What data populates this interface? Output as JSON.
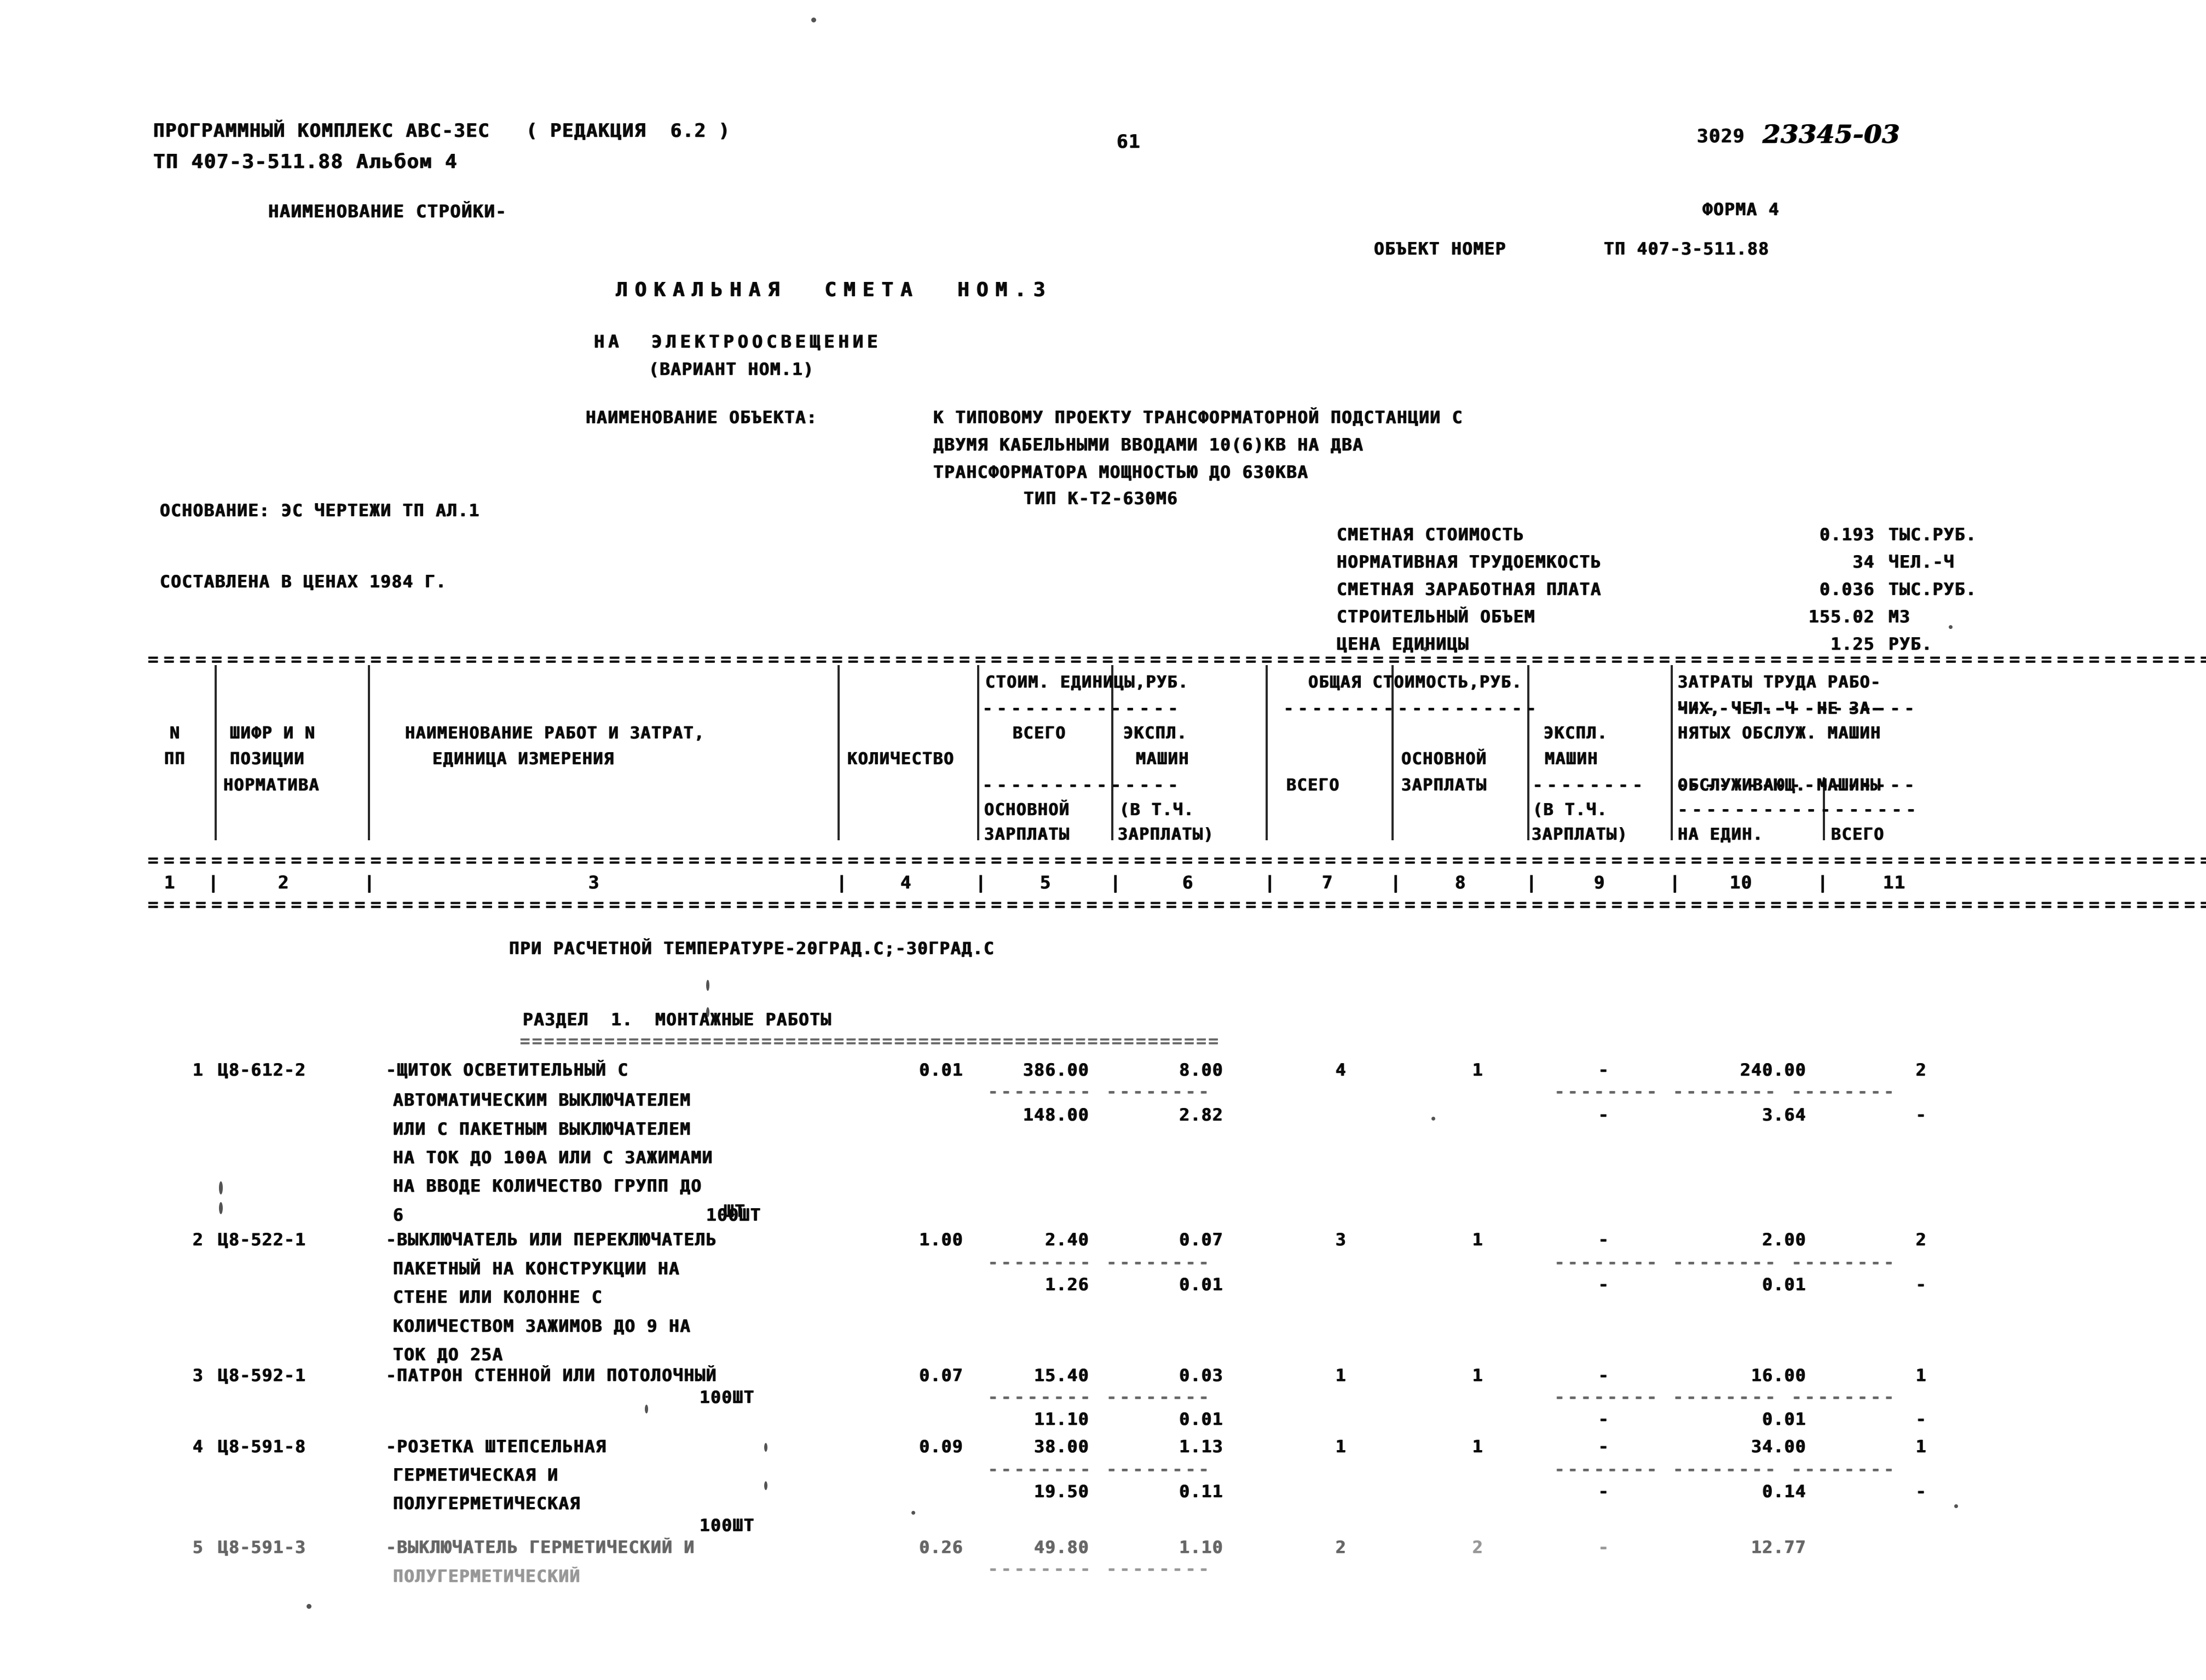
{
  "header": {
    "software_line": "ПРОГРАММНЫЙ КОМПЛЕКС АВС-3ЕС   ( РЕДАКЦИЯ  6.2 )",
    "project_line": "ТП 407-3-511.88 Альбом 4",
    "row_label": "НАИМЕНОВАНИЕ СТРОЙКИ-",
    "page_number": "61",
    "doc_code": "3029",
    "handwritten_code": "23345-03",
    "form_label": "ФОРМА 4",
    "object_number_label": "ОБЪЕКТ НОМЕР",
    "object_number_value": "ТП 407-3-511.88"
  },
  "title": {
    "line1": "ЛОКАЛЬНАЯ  СМЕТА  НОМ.3",
    "line2": "НА  ЭЛЕКТРООСВЕЩЕНИЕ",
    "line3": "(ВАРИАНТ НОМ.1)"
  },
  "object": {
    "label": "НАИМЕНОВАНИЕ ОБЪЕКТА:",
    "lines": [
      "К ТИПОВОМУ ПРОЕКТУ ТРАНСФОРМАТОРНОЙ ПОДСТАНЦИИ С",
      "ДВУМЯ КАБЕЛЬНЫМИ ВВОДАМИ 10(6)КВ НА ДВА",
      "ТРАНСФОРМАТОРА МОЩНОСТЬЮ ДО 630КВА",
      "ТИП К-Т2-630М6"
    ]
  },
  "basis": {
    "line1": "ОСНОВАНИЕ: ЭС ЧЕРТЕЖИ ТП АЛ.1",
    "line2": "СОСТАВЛЕНА В ЦЕНАХ 1984 Г."
  },
  "summary": [
    {
      "label": "СМЕТНАЯ СТОИМОСТЬ",
      "value": "0.193",
      "unit": "ТЫС.РУБ."
    },
    {
      "label": "НОРМАТИВНАЯ ТРУДОЕМКОСТЬ",
      "value": "34",
      "unit": "ЧЕЛ.-Ч"
    },
    {
      "label": "СМЕТНАЯ ЗАРАБОТНАЯ ПЛАТА",
      "value": "0.036",
      "unit": "ТЫС.РУБ."
    },
    {
      "label": "СТРОИТЕЛЬНЫЙ ОБЪЕМ",
      "value": "155.02",
      "unit": "М3"
    },
    {
      "label": "ЦЕНА ЕДИНИЦЫ",
      "value": "1.25",
      "unit": "РУБ."
    }
  ],
  "table": {
    "head": {
      "col1_l1": "N",
      "col1_l2": "ПП",
      "col2_l1": "ШИФР И N",
      "col2_l2": "ПОЗИЦИИ",
      "col2_l3": "НОРМАТИВА",
      "col3_l1": "НАИМЕНОВАНИЕ РАБОТ И ЗАТРАТ,",
      "col3_l2": "ЕДИНИЦА ИЗМЕРЕНИЯ",
      "col4": "КОЛИЧЕСТВО",
      "grp56": "СТОИМ. ЕДИНИЦЫ,РУБ.",
      "col5_l1": "ВСЕГО",
      "col5_l2": "ОСНОВНОЙ",
      "col5_l3": "ЗАРПЛАТЫ",
      "col6_l1": "ЭКСПЛ.",
      "col6_l2": "МАШИН",
      "col6_l3": "(В Т.Ч.",
      "col6_l4": "ЗАРПЛАТЫ)",
      "grp789": "ОБЩАЯ СТОИМОСТЬ,РУБ.",
      "col7": "ВСЕГО",
      "col8_l1": "ОСНОВНОЙ",
      "col8_l2": "ЗАРПЛАТЫ",
      "col9_l1": "ЭКСПЛ.",
      "col9_l2": "МАШИН",
      "col9_l3": "(В Т.Ч.",
      "col9_l4": "ЗАРПЛАТЫ)",
      "grp1011_l1": "ЗАТРАТЫ ТРУДА РАБО-",
      "grp1011_l2": "ЧИХ, ЧЕЛ.-Ч  НЕ ЗА-",
      "grp1011_l3": "НЯТЫХ ОБСЛУЖ. МАШИН",
      "grp1011_l4": "ОБСЛУЖИВАЮЩ. МАШИНЫ",
      "col10": "НА ЕДИН.",
      "col11": "ВСЕГО"
    },
    "colnums": [
      "1",
      "2",
      "3",
      "4",
      "5",
      "6",
      "7",
      "8",
      "9",
      "10",
      "11"
    ],
    "temperature_note": "ПРИ РАСЧЕТНОЙ ТЕМПЕРАТУРЕ-20ГРАД.С;-30ГРАД.С",
    "section_title": "РАЗДЕЛ  1.  МОНТАЖНЫЕ РАБОТЫ",
    "rows": [
      {
        "num": "1",
        "code": "Ц8-612-2",
        "desc": [
          "-ЩИТОК ОСВЕТИТЕЛЬНЫЙ С",
          "АВТОМАТИЧЕСКИМ ВЫКЛЮЧАТЕЛЕМ",
          "ИЛИ С ПАКЕТНЫМ ВЫКЛЮЧАТЕЛЕМ",
          "НА ТОК ДО 100А ИЛИ С ЗАЖИМАМИ",
          "НА ВВОДЕ КОЛИЧЕСТВО ГРУПП ДО",
          "6"
        ],
        "unit": "100ШТ",
        "qty": "0.01",
        "c5": "386.00",
        "c6": "8.00",
        "c7": "4",
        "c8": "1",
        "c9": "-",
        "c10": "240.00",
        "c11": "2",
        "c5b": "148.00",
        "c6b": "2.82",
        "c9b": "-",
        "c10b": "3.64",
        "c11b": "-"
      },
      {
        "num": "2",
        "code": "Ц8-522-1",
        "desc": [
          "-ВЫКЛЮЧАТЕЛЬ ИЛИ ПЕРЕКЛЮЧАТЕЛЬ",
          "ПАКЕТНЫЙ НА КОНСТРУКЦИИ НА",
          "СТЕНЕ ИЛИ КОЛОННЕ С",
          "КОЛИЧЕСТВОМ ЗАЖИМОВ ДО 9 НА",
          "ТОК ДО 25А"
        ],
        "unit": "ШТ",
        "qty": "1.00",
        "c5": "2.40",
        "c6": "0.07",
        "c7": "3",
        "c8": "1",
        "c9": "-",
        "c10": "2.00",
        "c11": "2",
        "c5b": "1.26",
        "c6b": "0.01",
        "c9b": "-",
        "c10b": "0.01",
        "c11b": "-"
      },
      {
        "num": "3",
        "code": "Ц8-592-1",
        "desc": [
          "-ПАТРОН СТЕННОЙ ИЛИ ПОТОЛОЧНЫЙ"
        ],
        "unit": "100ШТ",
        "qty": "0.07",
        "c5": "15.40",
        "c6": "0.03",
        "c7": "1",
        "c8": "1",
        "c9": "-",
        "c10": "16.00",
        "c11": "1",
        "c5b": "11.10",
        "c6b": "0.01",
        "c9b": "-",
        "c10b": "0.01",
        "c11b": "-"
      },
      {
        "num": "4",
        "code": "Ц8-591-8",
        "desc": [
          "-РОЗЕТКА ШТЕПСЕЛЬНАЯ",
          "ГЕРМЕТИЧЕСКАЯ И",
          "ПОЛУГЕРМЕТИЧЕСКАЯ"
        ],
        "unit": "100ШТ",
        "qty": "0.09",
        "c5": "38.00",
        "c6": "1.13",
        "c7": "1",
        "c8": "1",
        "c9": "-",
        "c10": "34.00",
        "c11": "1",
        "c5b": "19.50",
        "c6b": "0.11",
        "c9b": "-",
        "c10b": "0.14",
        "c11b": "-"
      },
      {
        "num": "5",
        "code": "Ц8-591-3",
        "desc": [
          "-ВЫКЛЮЧАТЕЛЬ ГЕРМЕТИЧЕСКИЙ И",
          "ПОЛУГЕРМЕТИЧЕСКИЙ"
        ],
        "unit": "",
        "qty": "0.26",
        "c5": "49.80",
        "c6": "1.10",
        "c7": "2",
        "c8": "2",
        "c9": "-",
        "c10": "12.77",
        "c11": "",
        "c5b": "",
        "c6b": "",
        "c9b": "",
        "c10b": "",
        "c11b": ""
      }
    ]
  }
}
